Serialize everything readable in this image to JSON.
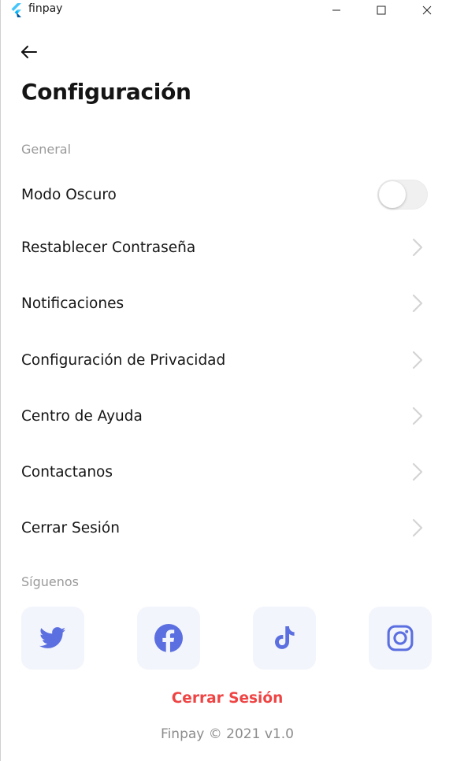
{
  "window": {
    "title": "finpay",
    "controls": [
      "minimize",
      "maximize",
      "close"
    ]
  },
  "header": {
    "back_icon": "arrow-left-icon",
    "title": "Configuración"
  },
  "general": {
    "section_label": "General",
    "items": [
      {
        "label": "Modo Oscuro",
        "control": "toggle",
        "toggle_on": false
      },
      {
        "label": "Restablecer Contraseña",
        "control": "chevron"
      },
      {
        "label": "Notificaciones",
        "control": "chevron"
      },
      {
        "label": "Configuración de Privacidad",
        "control": "chevron"
      },
      {
        "label": "Centro de Ayuda",
        "control": "chevron"
      },
      {
        "label": "Contactanos",
        "control": "chevron"
      },
      {
        "label": "Cerrar Sesión",
        "control": "chevron"
      }
    ]
  },
  "social": {
    "section_label": "Síguenos",
    "icons": [
      "twitter-icon",
      "facebook-icon",
      "tiktok-icon",
      "instagram-icon"
    ]
  },
  "logout_label": "Cerrar Sesión",
  "footer": "Finpay © 2021 v1.0",
  "colors": {
    "accent": "#5b6fe0",
    "danger": "#ef4444",
    "social_bg": "#f3f5fc",
    "muted": "#9a9a9a",
    "chevron": "#d4d4d4"
  }
}
